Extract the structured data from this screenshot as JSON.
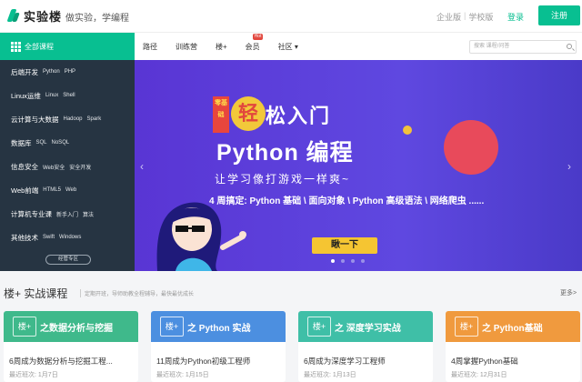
{
  "header": {
    "logo_text": "实验楼",
    "slogan": "做实验，学编程",
    "links": [
      "企业版",
      "学校版"
    ],
    "login": "登录",
    "register": "注册"
  },
  "nav": {
    "all_courses": "全部课程",
    "links": [
      "路径",
      "训练营",
      "楼+",
      "会员",
      "社区 ▾"
    ],
    "hot_badge": "Hot",
    "search_placeholder": "搜索 课程/问答"
  },
  "sidebar": {
    "items": [
      {
        "main": "后端开发",
        "subs": [
          "Python",
          "PHP"
        ]
      },
      {
        "main": "Linux运维",
        "subs": [
          "Linux",
          "Shell"
        ]
      },
      {
        "main": "云计算与大数据",
        "subs": [
          "Hadoop",
          "Spark"
        ]
      },
      {
        "main": "数据库",
        "subs": [
          "SQL",
          "NoSQL"
        ]
      },
      {
        "main": "信息安全",
        "subs": [
          "Web安全",
          "安全开发"
        ]
      },
      {
        "main": "Web前端",
        "subs": [
          "HTML5",
          "Web"
        ]
      },
      {
        "main": "计算机专业课",
        "subs": [
          "新手入门",
          "算法"
        ]
      },
      {
        "main": "其他技术",
        "subs": [
          "Swift",
          "Windows"
        ]
      }
    ],
    "special": "经管专区"
  },
  "banner": {
    "tag": "零基础",
    "light": "轻",
    "title_rest": "松入门",
    "title2": "Python 编程",
    "line3": "让学习像打游戏一样爽~",
    "line4": "4 周搞定: Python 基础 \\ 面向对象 \\ Python 高级语法 \\ 网络爬虫 ......",
    "cta": "瞅一下",
    "slide_count": 4,
    "active_slide": 0
  },
  "section": {
    "title": "楼+ 实战课程",
    "subtitle": "定期开班，导师助教全程辅导，最快最优成长",
    "more": "更多>"
  },
  "cards": [
    {
      "mini": "楼+",
      "head": "之数据分析与挖掘",
      "name": "6周成为数据分析与挖掘工程...",
      "meta_label": "最近班次:",
      "meta_date": "1月7日",
      "color": "#3fb98b"
    },
    {
      "mini": "楼+",
      "head": "之 Python 实战",
      "name": "11周成为Python初级工程师",
      "meta_label": "最近班次:",
      "meta_date": "1月15日",
      "color": "#4c8fe0"
    },
    {
      "mini": "楼+",
      "head": "之 深度学习实战",
      "name": "6周成为深度学习工程师",
      "meta_label": "最近班次:",
      "meta_date": "1月13日",
      "color": "#3fbfa7"
    },
    {
      "mini": "楼+",
      "head": "之 Python基础",
      "name": "4周掌握Python基础",
      "meta_label": "最近班次:",
      "meta_date": "12月31日",
      "color": "#f09a3e"
    }
  ]
}
